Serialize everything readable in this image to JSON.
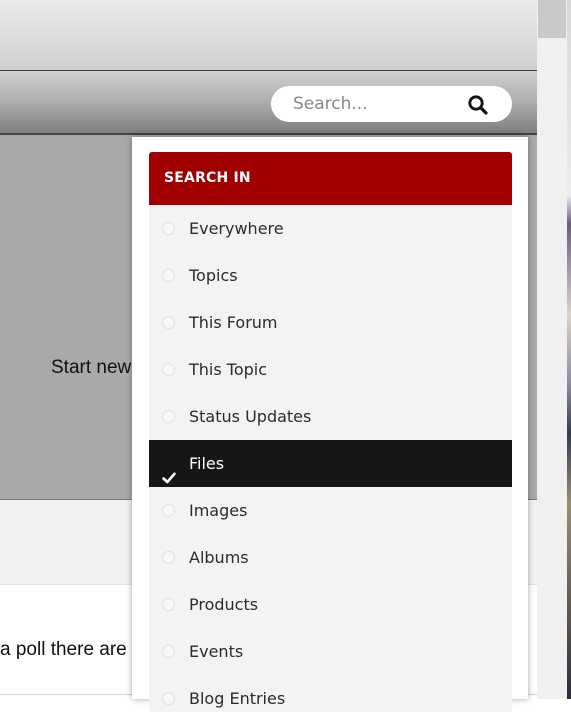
{
  "search": {
    "placeholder": "Search..."
  },
  "page": {
    "start_new_text": "Start new",
    "poll_text": "a poll there are"
  },
  "dropdown": {
    "header": "SEARCH IN",
    "selected_index": 5,
    "items": [
      {
        "label": "Everywhere",
        "selected": false
      },
      {
        "label": "Topics",
        "selected": false
      },
      {
        "label": "This Forum",
        "selected": false
      },
      {
        "label": "This Topic",
        "selected": false
      },
      {
        "label": "Status Updates",
        "selected": false
      },
      {
        "label": "Files",
        "selected": true
      },
      {
        "label": "Images",
        "selected": false
      },
      {
        "label": "Albums",
        "selected": false
      },
      {
        "label": "Products",
        "selected": false
      },
      {
        "label": "Events",
        "selected": false
      },
      {
        "label": "Blog Entries",
        "selected": false
      }
    ]
  },
  "colors": {
    "header_bg": "#a00000",
    "selected_bg": "#161616"
  },
  "icons": {
    "search": "magnifying-glass-icon",
    "selected": "check-icon",
    "unselected": "radio-circle-icon"
  }
}
